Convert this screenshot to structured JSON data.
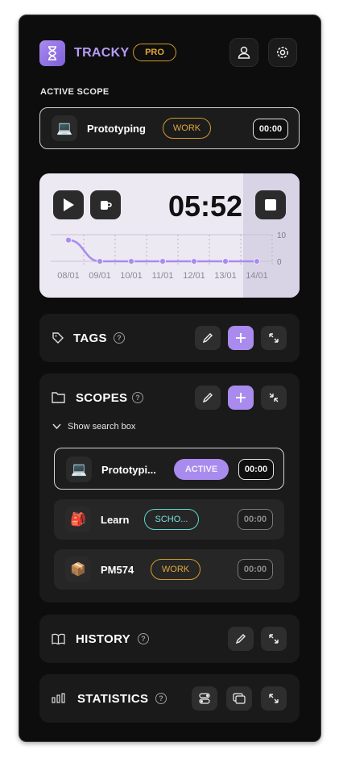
{
  "header": {
    "title": "TRACKY",
    "badge": "PRO"
  },
  "active_scope": {
    "label": "ACTIVE SCOPE",
    "name": "Prototyping",
    "tag": "WORK",
    "time": "00:00"
  },
  "timer": {
    "display": "05:52",
    "chart": {
      "dates": [
        "08/01",
        "09/01",
        "10/01",
        "11/01",
        "12/01",
        "13/01",
        "14/01"
      ],
      "values": [
        8,
        0,
        0,
        0,
        0,
        0,
        0
      ],
      "y_ticks": [
        "10",
        "0"
      ]
    }
  },
  "tags_panel": {
    "title": "TAGS",
    "help": "?"
  },
  "scopes_panel": {
    "title": "SCOPES",
    "help": "?",
    "search_toggle": "Show search box",
    "items": [
      {
        "name": "Prototypi...",
        "tag": "ACTIVE",
        "time": "00:00",
        "emoji": "💻"
      },
      {
        "name": "Learn",
        "tag": "SCHO...",
        "time": "00:00",
        "emoji": "🎒"
      },
      {
        "name": "PM574",
        "tag": "WORK",
        "time": "00:00",
        "emoji": "📦"
      }
    ]
  },
  "history_panel": {
    "title": "HISTORY",
    "help": "?"
  },
  "statistics_panel": {
    "title": "STATISTICS",
    "help": "?"
  },
  "colors": {
    "accent": "#a98bee",
    "work": "#e0a83a",
    "school": "#5fd6d0",
    "background": "#0d0d0d"
  },
  "icons": {
    "logo": "hourglass-icon",
    "user": "user-icon",
    "settings": "gear-icon"
  }
}
